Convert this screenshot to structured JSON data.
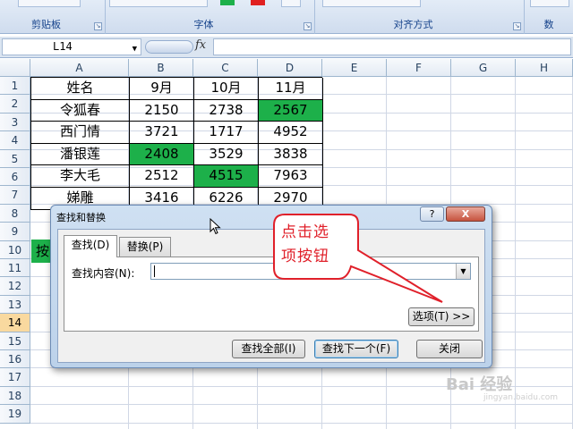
{
  "ribbon": {
    "groups": [
      {
        "label": "剪贴板"
      },
      {
        "label": "字体"
      },
      {
        "label": "对齐方式"
      },
      {
        "label": "数"
      }
    ]
  },
  "formula_bar": {
    "name_box": "L14",
    "fx_label": "fx",
    "formula": ""
  },
  "sheet": {
    "columns": [
      "A",
      "B",
      "C",
      "D",
      "E",
      "F",
      "G",
      "H"
    ],
    "rows": [
      "1",
      "2",
      "3",
      "4",
      "5",
      "6",
      "7",
      "8",
      "9",
      "10",
      "11",
      "12",
      "13",
      "14",
      "15",
      "16",
      "17",
      "18",
      "19"
    ],
    "active_row": "14",
    "highlight_color": "#1db04a",
    "data": [
      [
        "姓名",
        "9月",
        "10月",
        "11月"
      ],
      [
        "令狐春",
        "2150",
        "2738",
        "2567"
      ],
      [
        "西门情",
        "3721",
        "1717",
        "4952"
      ],
      [
        "潘银莲",
        "2408",
        "3529",
        "3838"
      ],
      [
        "李大毛",
        "2512",
        "4515",
        "7963"
      ],
      [
        "娣雕",
        "3416",
        "6226",
        "2970"
      ]
    ],
    "green_cells": [
      [
        1,
        3
      ],
      [
        3,
        1
      ],
      [
        4,
        2
      ]
    ],
    "row9_partial": "按"
  },
  "dialog": {
    "title": "查找和替换",
    "help_label": "?",
    "close_label": "X",
    "tabs": [
      {
        "label": "查找(D)",
        "active": true
      },
      {
        "label": "替换(P)",
        "active": false
      }
    ],
    "find_label": "查找内容(N):",
    "find_value": "",
    "options_button": "选项(T) >>",
    "find_all_button": "查找全部(I)",
    "find_next_button": "查找下一个(F)",
    "close_button": "关闭"
  },
  "callout": {
    "text_line1": "点击选",
    "text_line2": "项按钮",
    "color": "#e0202a"
  },
  "watermark": {
    "text": "Bai 经验",
    "sub": "jingyan.baidu.com"
  }
}
